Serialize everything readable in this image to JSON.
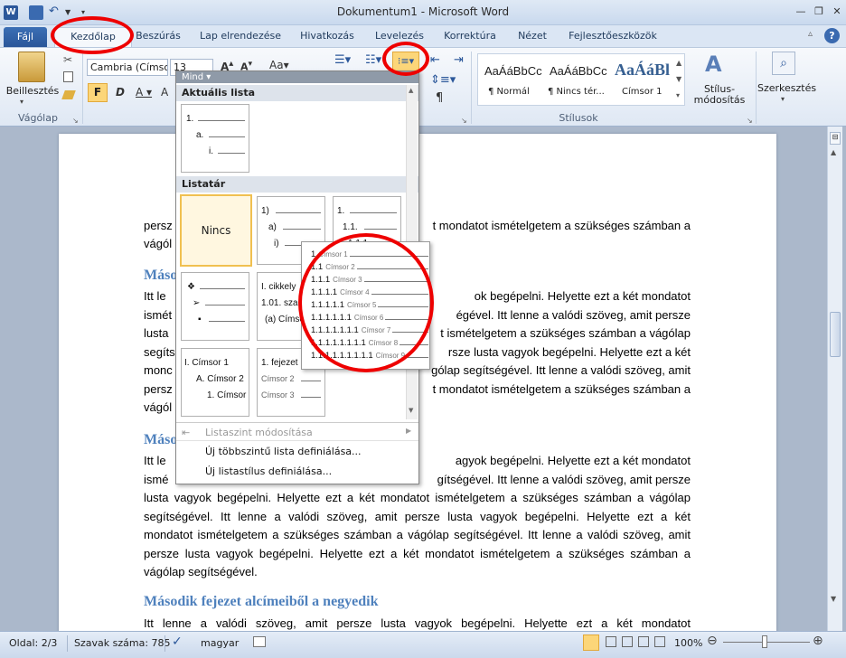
{
  "titlebar": {
    "title": "Dokumentum1 - Microsoft Word"
  },
  "tabs": [
    {
      "label": "Fájl"
    },
    {
      "label": "Kezdőlap"
    },
    {
      "label": "Beszúrás"
    },
    {
      "label": "Lap elrendezése"
    },
    {
      "label": "Hivatkozás"
    },
    {
      "label": "Levelezés"
    },
    {
      "label": "Korrektúra"
    },
    {
      "label": "Nézet"
    },
    {
      "label": "Fejlesztőeszközök"
    }
  ],
  "ribbon": {
    "paste": "Beillesztés",
    "clipboard": "Vágólap",
    "font_name": "Cambria (Címso",
    "font_size": "13",
    "bold": "F",
    "styles_group": "Stílusok",
    "style_tiles": [
      {
        "preview": "AaÁáBbCc",
        "label": "¶ Normál"
      },
      {
        "preview": "AaÁáBbCc",
        "label": "¶ Nincs tér..."
      },
      {
        "preview": "AaÁáBl",
        "label": "Címsor 1"
      }
    ],
    "style_change": "Stílus-\nmódosítás",
    "edit": "Szerkesztés"
  },
  "dropdown": {
    "filter": "Mind",
    "section_current": "Aktuális lista",
    "section_library": "Listatár",
    "current_list": [
      "1.",
      "a.",
      "i."
    ],
    "lib_none": "Nincs",
    "lib_t1": [
      "1)",
      "a)",
      "i)"
    ],
    "lib_t2": [
      "1.",
      "1.1.",
      "1.1.1."
    ],
    "lib_t4": [
      "❖",
      "➢",
      "▪"
    ],
    "lib_t5": [
      "I. cikkely",
      "1.01. sza",
      "(a) Címsor"
    ],
    "lib_t7": [
      "I. Címsor 1",
      "A. Címsor 2",
      "1. Címsor"
    ],
    "lib_t8": [
      "1. fejezet",
      "Címsor 2",
      "Címsor 3"
    ],
    "commands": [
      "Listaszint módosítása",
      "Új többszintű lista definiálása...",
      "Új listastílus definiálása..."
    ]
  },
  "flyout": {
    "rows": [
      {
        "n": "1",
        "c": "Címsor 1"
      },
      {
        "n": "1.1",
        "c": "Címsor 2"
      },
      {
        "n": "1.1.1",
        "c": "Címsor 3"
      },
      {
        "n": "1.1.1.1",
        "c": "Címsor 4"
      },
      {
        "n": "1.1.1.1.1",
        "c": "Címsor 5"
      },
      {
        "n": "1.1.1.1.1.1",
        "c": "Címsor 6"
      },
      {
        "n": "1.1.1.1.1.1.1",
        "c": "Címsor 7"
      },
      {
        "n": "1.1.1.1.1.1.1.1",
        "c": "Címsor 8"
      },
      {
        "n": "1.1.1.1.1.1.1.1.1",
        "c": "Címsor 9"
      }
    ]
  },
  "document": {
    "p1_a": "persz",
    "p1_b": "t mondatot ismételgetem a szükséges számban a",
    "p1_c": "vágól",
    "h2a": "Máso",
    "p2": [
      {
        "l": "Itt le",
        "r": "ok begépelni. Helyette ezt a két mondatot"
      },
      {
        "l": "ismét",
        "r": "égével. Itt lenne a valódi szöveg, amit persze"
      },
      {
        "l": "lusta",
        "r": "t ismételgetem a szükséges számban a vágólap"
      },
      {
        "l": "segíts",
        "r": "rsze lusta vagyok begépelni. Helyette ezt a két"
      },
      {
        "l": "monc",
        "r": "gólap segítségével. Itt lenne a valódi szöveg, amit"
      },
      {
        "l": "persz",
        "r": "t mondatot ismételgetem a szükséges számban a"
      },
      {
        "l": "vágól",
        "r": ""
      }
    ],
    "h2b": "Máso",
    "p3_top": [
      {
        "l": "Itt le",
        "r": "agyok begépelni. Helyette ezt a két mondatot"
      },
      {
        "l": "ismé",
        "r": "gítségével. Itt lenne a valódi szöveg, amit persze"
      }
    ],
    "p3_full": [
      "lusta vagyok begépelni. Helyette ezt a két mondatot ismételgetem a szükséges számban a vágólap",
      "segítségével. Itt lenne a valódi szöveg, amit persze lusta vagyok begépelni. Helyette ezt a két",
      "mondatot ismételgetem a szükséges számban a vágólap segítségével. Itt lenne a valódi szöveg, amit",
      "persze lusta vagyok begépelni. Helyette ezt a két mondatot ismételgetem a szükséges számban a",
      "vágólap segítségével."
    ],
    "h3": "Második fejezet alcímeiből a negyedik",
    "p4": "Itt lenne a valódi szöveg, amit persze lusta vagyok begépelni. Helyette ezt a két mondatot"
  },
  "status": {
    "page": "Oldal: 2/3",
    "words": "Szavak száma: 785",
    "lang": "magyar",
    "zoom": "100%"
  }
}
